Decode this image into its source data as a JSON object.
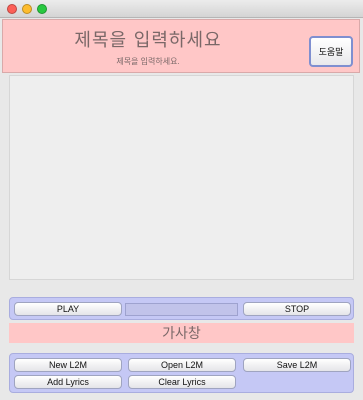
{
  "window": {
    "traffic_lights": [
      "close",
      "minimize",
      "zoom"
    ]
  },
  "header": {
    "title": "제목을 입력하세요",
    "subtitle": "제목을 입력하세요.",
    "help_label": "도움말"
  },
  "controls": {
    "play_label": "PLAY",
    "stop_label": "STOP",
    "progress_value": 0
  },
  "lyrics": {
    "label": "가사창"
  },
  "file_buttons": {
    "new_l2m": "New L2M",
    "open_l2m": "Open L2M",
    "save_l2m": "Save L2M",
    "add_lyrics": "Add Lyrics",
    "clear_lyrics": "Clear Lyrics"
  },
  "colors": {
    "header_bg": "#ffc7c7",
    "panel_bg": "#c5c8f5",
    "window_bg": "#e8e8e8"
  }
}
